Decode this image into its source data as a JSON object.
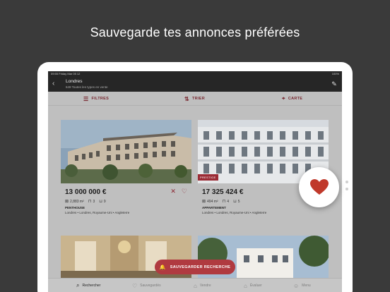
{
  "headline": "Sauvegarde tes annonces préférées",
  "status": {
    "time": "09:55 Friday Mar 05 12",
    "battery": "100%"
  },
  "header": {
    "city": "Londres",
    "subtitle": "649 Toutes les types en vente"
  },
  "filters": [
    {
      "label": "FILTRES",
      "icon": "sliders-icon"
    },
    {
      "label": "TRIER",
      "icon": "sort-icon"
    },
    {
      "label": "CARTE",
      "icon": "map-pin-icon"
    }
  ],
  "listings": [
    {
      "price": "13 000 000 €",
      "area": "2,883 m²",
      "beds": "3",
      "baths": "9",
      "type": "PENTHOUSE",
      "location": "Londres • Londres, Royaume-Uni • Angleterre",
      "badge": ""
    },
    {
      "price": "17 325 424 €",
      "area": "494 m²",
      "beds": "4",
      "baths": "5",
      "type": "APPARTEMENT",
      "location": "Londres • Londres, Royaume-Uni • Angleterre",
      "badge": "PRESTIGE"
    }
  ],
  "save_search": "SAUVEGARDER RECHERCHE",
  "tabs": [
    {
      "label": "Rechercher",
      "icon": "search-icon",
      "active": true
    },
    {
      "label": "Sauvegardés",
      "icon": "heart-icon",
      "active": false
    },
    {
      "label": "Vendre",
      "icon": "tag-icon",
      "active": false
    },
    {
      "label": "Évaluer",
      "icon": "house-icon",
      "active": false
    },
    {
      "label": "Menu",
      "icon": "menu-icon",
      "active": false
    }
  ],
  "colors": {
    "accent": "#9b2b35",
    "favorite": "#c0392b",
    "background": "#3a3a3a"
  }
}
